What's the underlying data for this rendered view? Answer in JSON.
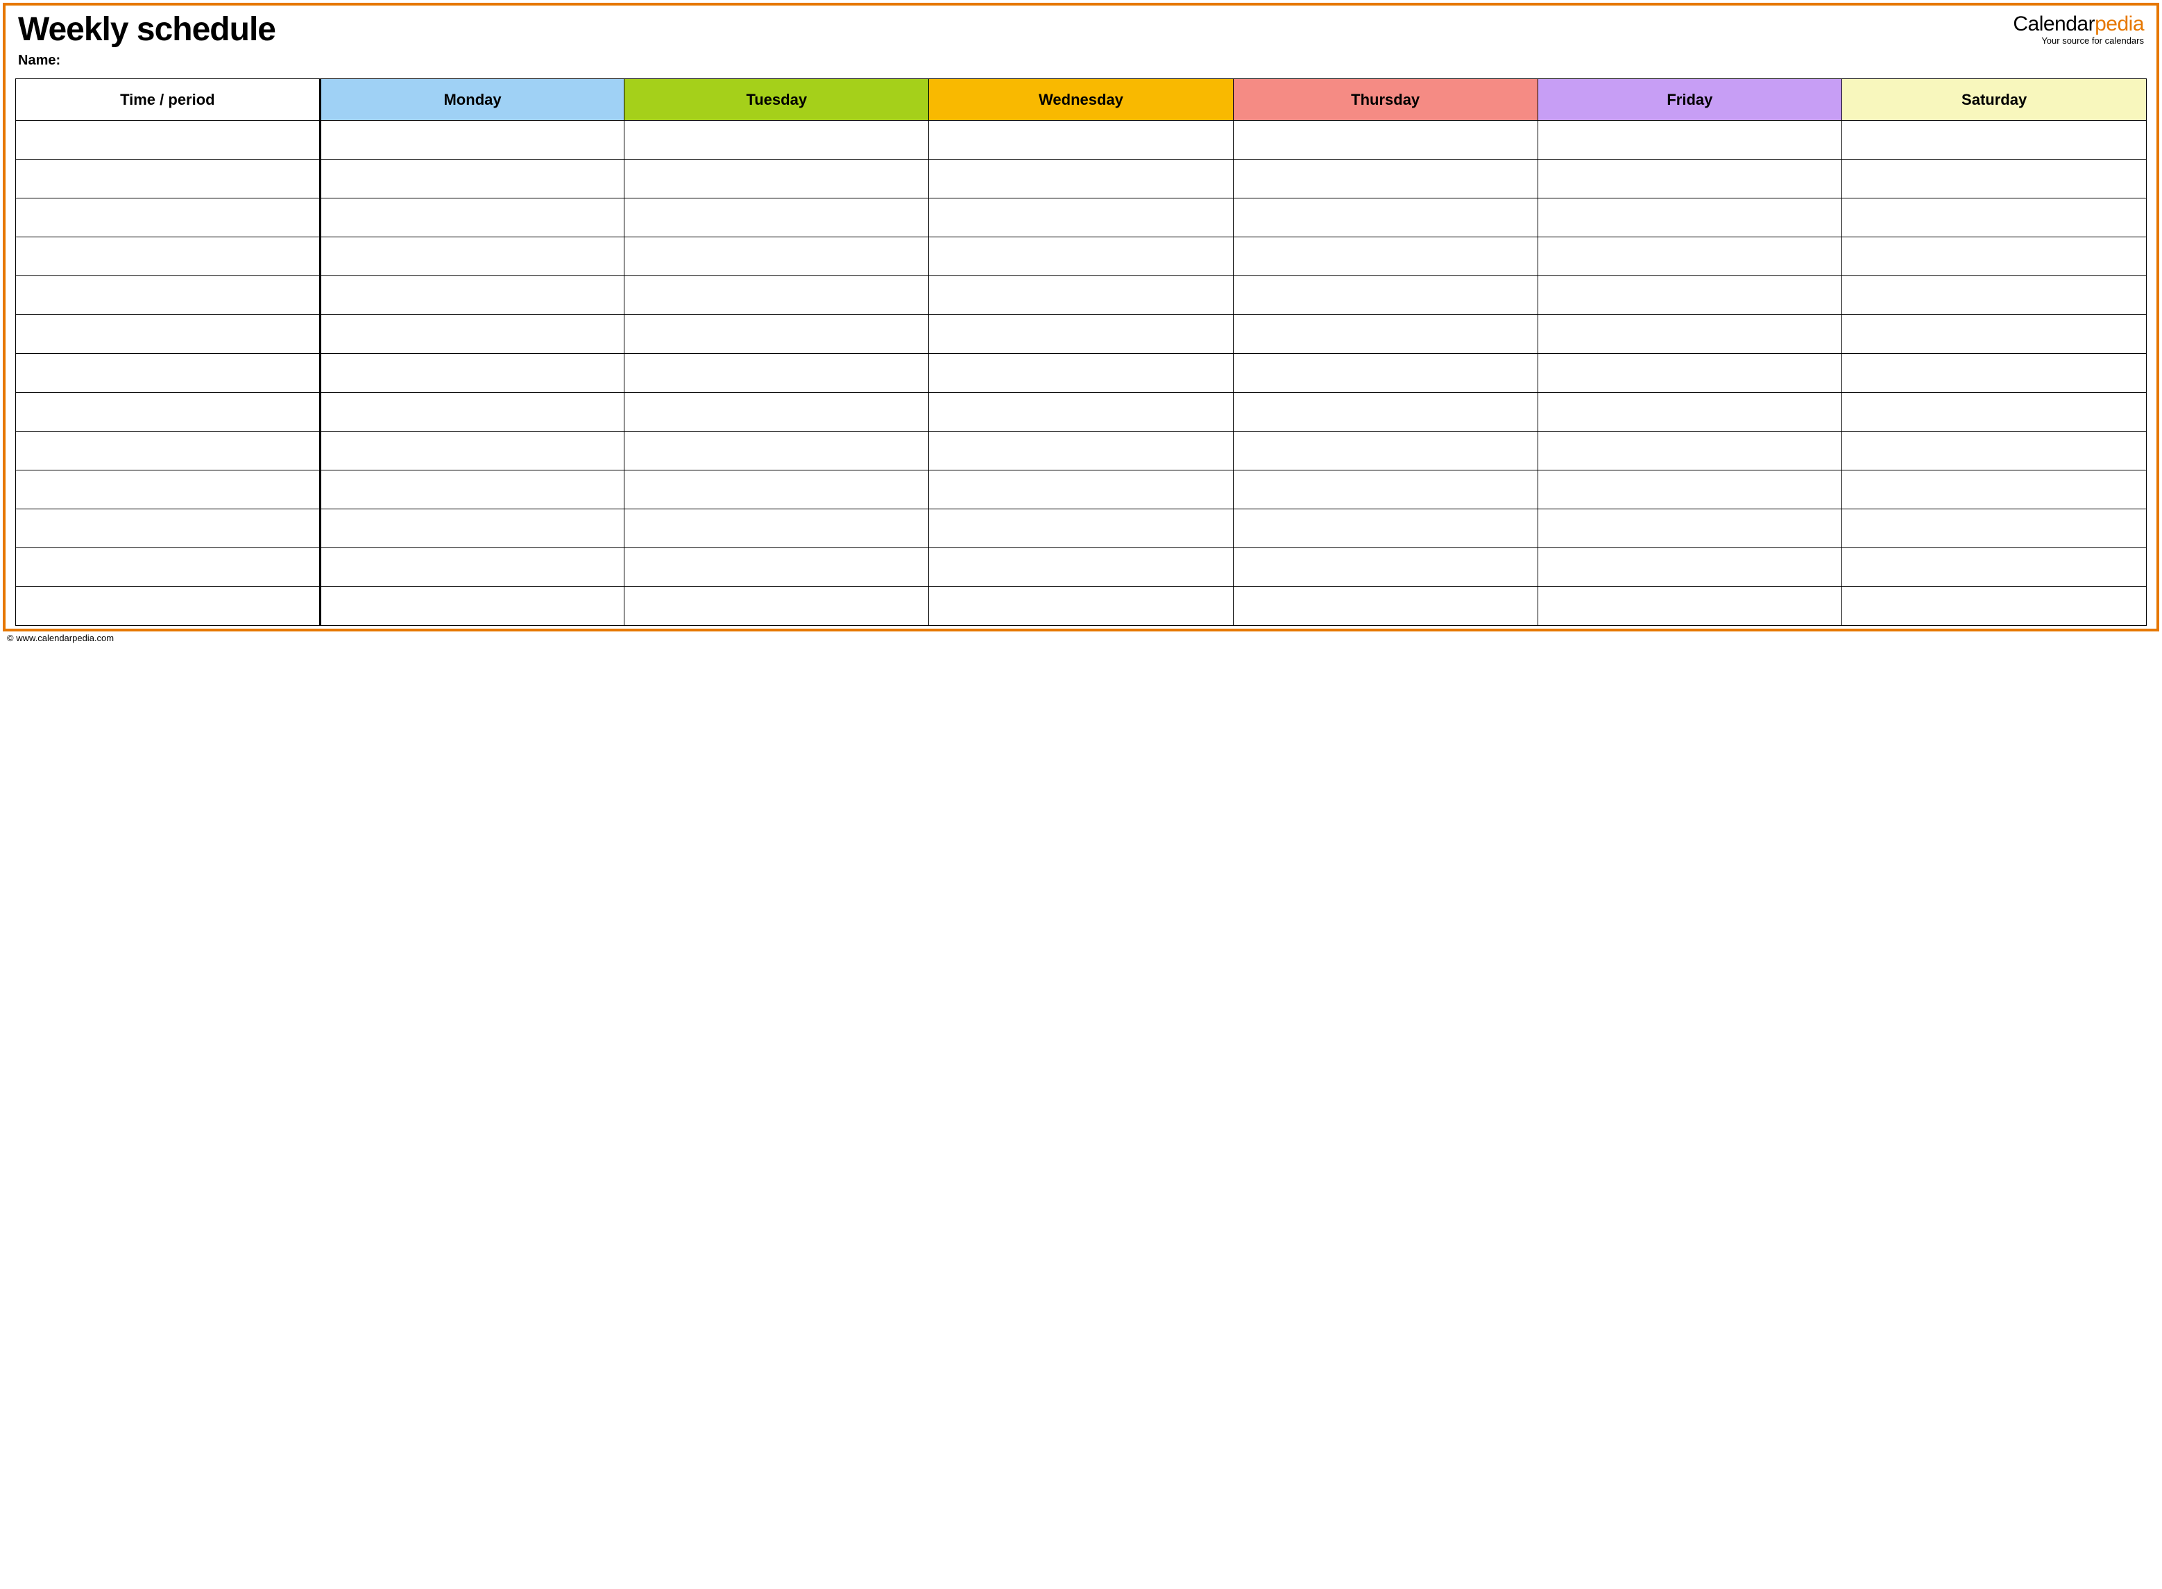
{
  "title": "Weekly schedule",
  "name_label": "Name:",
  "name_value": "",
  "brand": {
    "prefix": "Calendar",
    "suffix": "pedia",
    "tagline": "Your source for calendars"
  },
  "columns": {
    "time": "Time / period",
    "days": [
      "Monday",
      "Tuesday",
      "Wednesday",
      "Thursday",
      "Friday",
      "Saturday"
    ]
  },
  "day_colors": [
    "#9fd1f5",
    "#a5d01a",
    "#f9b900",
    "#f58b84",
    "#c79ef5",
    "#f8f7bd"
  ],
  "row_count": 13,
  "footer": "© www.calendarpedia.com"
}
